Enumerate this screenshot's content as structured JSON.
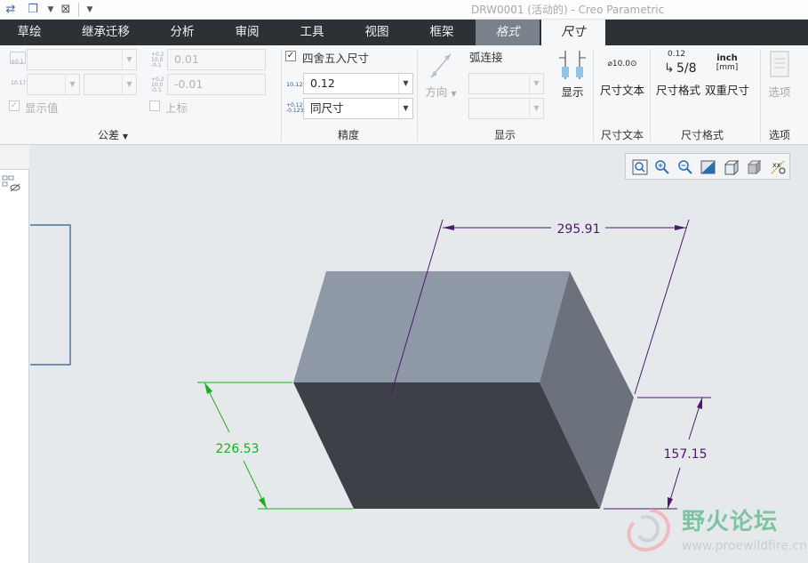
{
  "window": {
    "title": "DRW0001 (活动的) - Creo Parametric"
  },
  "tabs": [
    {
      "label": "草绘"
    },
    {
      "label": "继承迁移"
    },
    {
      "label": "分析"
    },
    {
      "label": "审阅"
    },
    {
      "label": "工具"
    },
    {
      "label": "视图"
    },
    {
      "label": "框架"
    },
    {
      "label": "格式"
    },
    {
      "label": "尺寸"
    }
  ],
  "ribbon": {
    "tolerance": {
      "upper_value": "0.01",
      "lower_value": "-0.01",
      "show_value_label": "显示值",
      "superscript_label": "上标",
      "group_label": "公差",
      "icon_texts": {
        "plusminus": "±0.1",
        "tol1": "10.17",
        "tol_up": "+0.2 10.0 -0.1",
        "tol_lo": "+0.2 10.0 -0.1"
      }
    },
    "precision": {
      "round_label": "四舍五入尺寸",
      "round_checked": true,
      "decimal_value": "0.12",
      "decimal_icon": "10.123",
      "tolerance_value": "同尺寸",
      "tolerance_icon": "+0.123 -0.123",
      "group_label": "精度"
    },
    "display": {
      "direction_label": "方向",
      "arc_label": "弧连接",
      "show_label": "显示",
      "group_label": "显示"
    },
    "dimtext": {
      "button_label": "尺寸文本",
      "icon_text": "⌀10.0⊙",
      "group_label": "尺寸文本"
    },
    "dimformat": {
      "format_label": "尺寸格式",
      "format_icon_top": "0.12",
      "format_icon_bottom": "5/8",
      "dual_label": "双重尺寸",
      "dual_icon_top": "inch",
      "dual_icon_bottom": "[mm]",
      "group_label": "尺寸格式"
    },
    "options": {
      "button_label": "选项",
      "group_label": "选项"
    }
  },
  "drawing": {
    "dimensions": [
      {
        "value": "295.91",
        "color": "#4a1a6b"
      },
      {
        "value": "226.53",
        "color": "#1ab01a"
      },
      {
        "value": "157.15",
        "color": "#4a1a6b"
      }
    ]
  },
  "watermark": {
    "title": "野火论坛",
    "url": "www.proewildfire.cn"
  },
  "colors": {
    "tab_bar": "#2c3136",
    "ribbon": "#f6f7f8",
    "canvas": "#e6e9ec",
    "box_top": "#8e98a6",
    "box_front": "#3d4047",
    "box_side": "#6c727c"
  }
}
